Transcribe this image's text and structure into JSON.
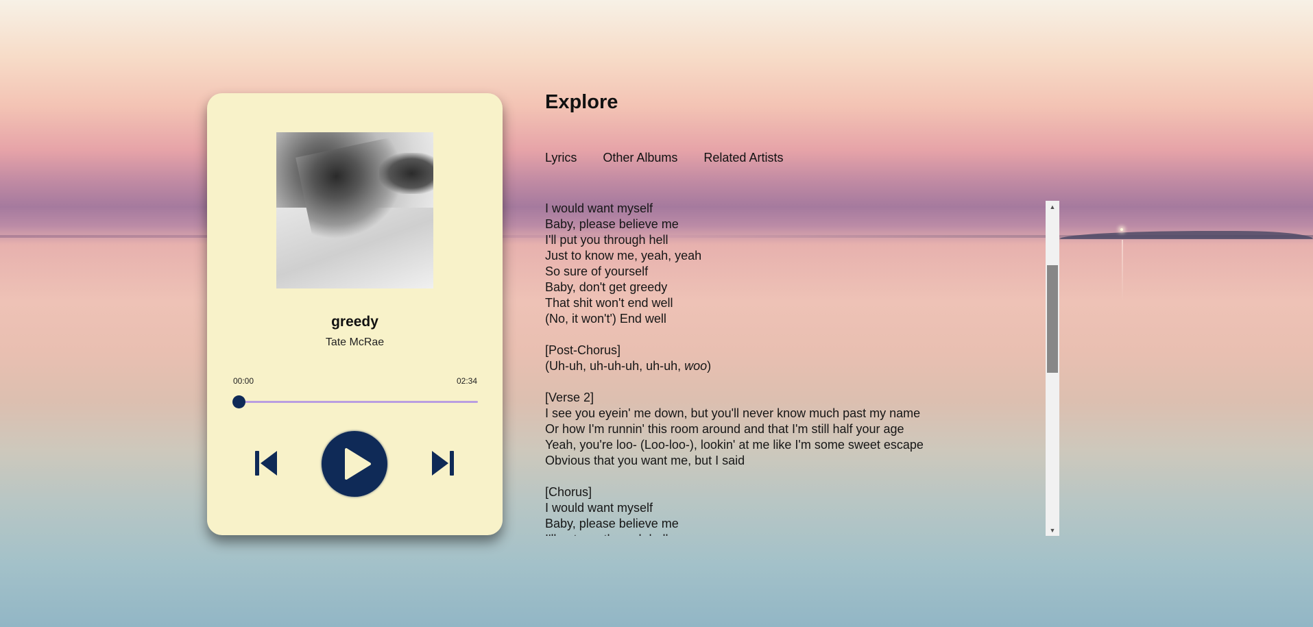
{
  "colors": {
    "card_bg": "#f8f2c9",
    "accent": "#0f2a57",
    "progress_track": "#b99ee0"
  },
  "player": {
    "cover_alt": "album cover",
    "title": "greedy",
    "artist": "Tate McRae",
    "time_current": "00:00",
    "time_total": "02:34",
    "progress": 0,
    "controls": {
      "prev_icon": "skip-previous-icon",
      "play_icon": "play-icon",
      "next_icon": "skip-next-icon"
    }
  },
  "explore": {
    "heading": "Explore",
    "tabs": [
      {
        "label": "Lyrics"
      },
      {
        "label": "Other Albums"
      },
      {
        "label": "Related Artists"
      }
    ],
    "lyrics": "I would want myself\nBaby, please believe me\nI'll put you through hell\nJust to know me, yeah, yeah\nSo sure of yourself\nBaby, don't get greedy\nThat shit won't end well\n(No, it won't') End well\n\n[Post-Chorus]\n(Uh-uh, uh-uh-uh, uh-uh, woo)\n\n[Verse 2]\nI see you eyein' me down, but you'll never know much past my name\nOr how I'm runnin' this room around and that I'm still half your age\nYeah, you're loo- (Loo-loo-), lookin' at me like I'm some sweet escape\nObvious that you want me, but I said\n\n[Chorus]\nI would want myself\nBaby, please believe me\nI'll put you through hell"
  }
}
